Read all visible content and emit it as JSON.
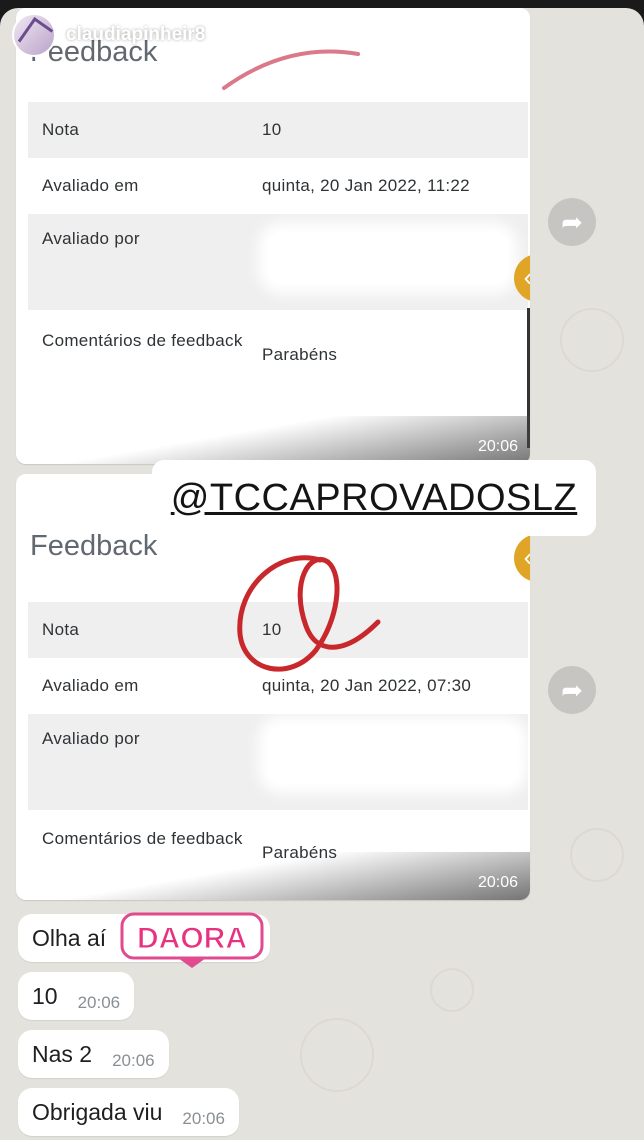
{
  "story": {
    "username": "claudiapinheir8"
  },
  "bubble1": {
    "heading": "Feedback",
    "rows": [
      {
        "label": "Nota",
        "value": "10"
      },
      {
        "label": "Avaliado em",
        "value": "quinta, 20 Jan 2022, 11:22"
      },
      {
        "label": "Avaliado por",
        "value": ""
      },
      {
        "label": "Comentários de feedback",
        "value": "Parabéns"
      }
    ],
    "time": "20:06"
  },
  "bubble2": {
    "heading": "Feedback",
    "rows": [
      {
        "label": "Nota",
        "value": "10"
      },
      {
        "label": "Avaliado em",
        "value": "quinta, 20 Jan 2022, 07:30"
      },
      {
        "label": "Avaliado por",
        "value": ""
      },
      {
        "label": "Comentários de feedback",
        "value": "Parabéns"
      }
    ],
    "time": "20:06"
  },
  "sticker": {
    "mention": "@TCCAPROVADOSLZ",
    "gif_text": "DAORA"
  },
  "messages": [
    {
      "text": "Olha aí",
      "time": ""
    },
    {
      "text": "10",
      "time": "20:06"
    },
    {
      "text": "Nas 2",
      "time": "20:06"
    },
    {
      "text": "Obrigada viu",
      "time": "20:06"
    }
  ],
  "icons": {
    "forward": "forward-arrow-icon",
    "collapse": "chevron-left-icon"
  },
  "colors": {
    "chat_bg": "#e4e2dc",
    "bubble": "#ffffff",
    "accent_tab": "#e0a526",
    "annotation_red": "#c8282c"
  }
}
